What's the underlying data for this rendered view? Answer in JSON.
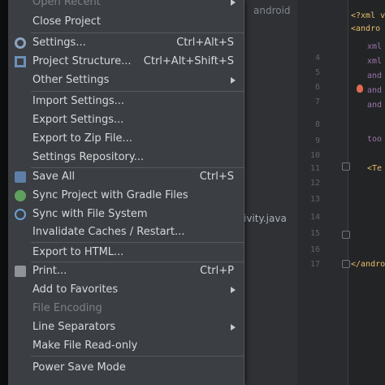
{
  "background": {
    "breadcrumb_text": "android",
    "project_text": "ivity.java",
    "line_numbers": [
      "4",
      "5",
      "6",
      "7",
      "8",
      "9",
      "10",
      "11",
      "12",
      "13",
      "14",
      "15",
      "16",
      "17"
    ],
    "code_lines": [
      "<?xml v",
      "<andro",
      "xml",
      "xml",
      "and",
      "and",
      "and",
      "too",
      "<Te",
      "</andro"
    ]
  },
  "menu": {
    "items": [
      {
        "label": "Open Recent",
        "shortcut": "",
        "submenu": true,
        "disabled": true
      },
      {
        "label": "Close Project",
        "shortcut": "",
        "submenu": false
      },
      {
        "label": "Settings...",
        "shortcut": "Ctrl+Alt+S",
        "icon": "gear-icon"
      },
      {
        "label": "Project Structure...",
        "shortcut": "Ctrl+Alt+Shift+S",
        "icon": "project-structure-icon"
      },
      {
        "label": "Other Settings",
        "shortcut": "",
        "submenu": true
      },
      {
        "label": "Import Settings...",
        "shortcut": ""
      },
      {
        "label": "Export Settings...",
        "shortcut": ""
      },
      {
        "label": "Export to Zip File...",
        "shortcut": ""
      },
      {
        "label": "Settings Repository...",
        "shortcut": ""
      },
      {
        "label": "Save All",
        "shortcut": "Ctrl+S",
        "icon": "save-icon"
      },
      {
        "label": "Sync Project with Gradle Files",
        "shortcut": "",
        "icon": "gradle-sync-icon"
      },
      {
        "label": "Sync with File System",
        "shortcut": "",
        "icon": "sync-icon"
      },
      {
        "label": "Invalidate Caches / Restart...",
        "shortcut": ""
      },
      {
        "label": "Export to HTML...",
        "shortcut": ""
      },
      {
        "label": "Print...",
        "shortcut": "Ctrl+P",
        "icon": "print-icon"
      },
      {
        "label": "Add to Favorites",
        "shortcut": "",
        "submenu": true
      },
      {
        "label": "File Encoding",
        "shortcut": "",
        "disabled": true
      },
      {
        "label": "Line Separators",
        "shortcut": "",
        "submenu": true
      },
      {
        "label": "Make File Read-only",
        "shortcut": ""
      },
      {
        "label": "Power Save Mode",
        "shortcut": ""
      }
    ]
  }
}
